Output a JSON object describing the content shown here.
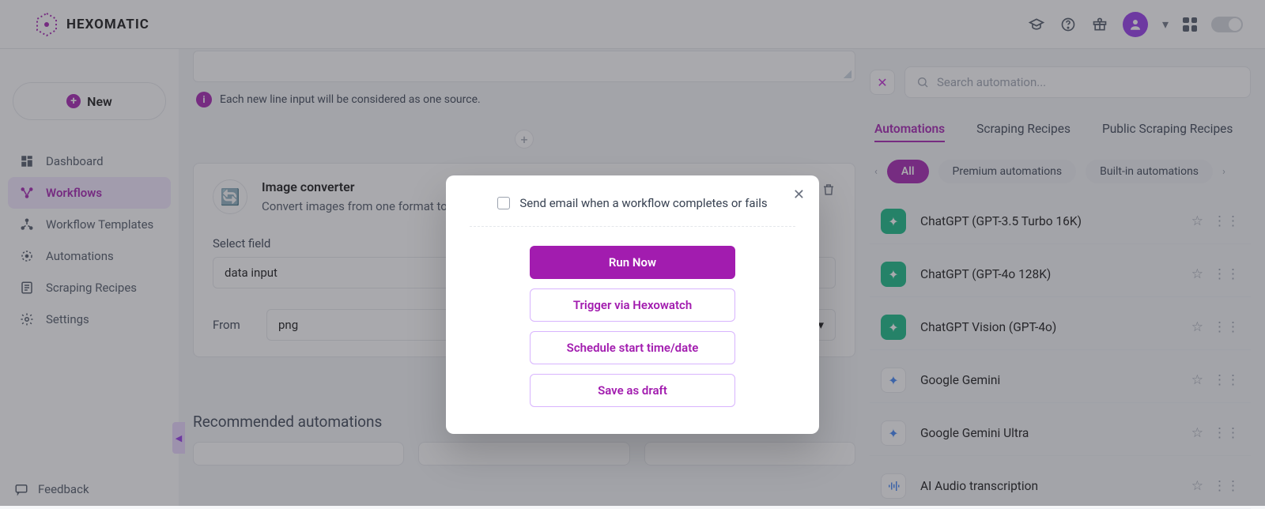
{
  "brand": "HEXOMATIC",
  "new_button": "New",
  "sidebar": {
    "items": [
      {
        "label": "Dashboard"
      },
      {
        "label": "Workflows"
      },
      {
        "label": "Workflow Templates"
      },
      {
        "label": "Automations"
      },
      {
        "label": "Scraping Recipes"
      },
      {
        "label": "Settings"
      }
    ],
    "feedback": "Feedback"
  },
  "main": {
    "hint": "Each new line input will be considered as one source.",
    "card": {
      "title": "Image converter",
      "subtitle": "Convert images from one format to a"
    },
    "select_field_label": "Select field",
    "select_field_value": "data input",
    "from_label": "From",
    "from_value": "png",
    "recommended_title": "Recommended automations"
  },
  "rightpanel": {
    "search_placeholder": "Search automation...",
    "tabs": [
      "Automations",
      "Scraping Recipes",
      "Public Scraping Recipes"
    ],
    "chips": [
      "All",
      "Premium automations",
      "Built-in automations"
    ],
    "items": [
      {
        "name": "ChatGPT (GPT-3.5 Turbo 16K)",
        "iconClass": "green"
      },
      {
        "name": "ChatGPT (GPT-4o 128K)",
        "iconClass": "green"
      },
      {
        "name": "ChatGPT Vision (GPT-4o)",
        "iconClass": "green"
      },
      {
        "name": "Google Gemini",
        "iconClass": "blue"
      },
      {
        "name": "Google Gemini Ultra",
        "iconClass": "blue"
      },
      {
        "name": "AI Audio transcription",
        "iconClass": "bars"
      }
    ]
  },
  "modal": {
    "checkbox_label": "Send email when a workflow completes or fails",
    "buttons": {
      "run": "Run Now",
      "trigger": "Trigger via Hexowatch",
      "schedule": "Schedule start time/date",
      "draft": "Save as draft"
    }
  }
}
